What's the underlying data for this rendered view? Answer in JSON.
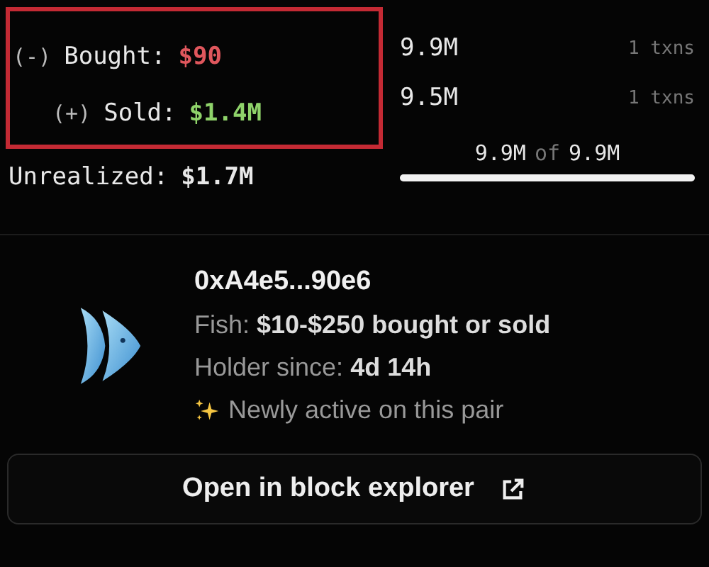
{
  "summary": {
    "highlighted": true,
    "trades": [
      {
        "kind": "buy",
        "sign": "(-)",
        "label": "Bought:",
        "amount": "$90",
        "tokens": "9.9M",
        "txns": "1 txns"
      },
      {
        "kind": "sell",
        "sign": "(+)",
        "label": "Sold:",
        "amount": "$1.4M",
        "tokens": "9.5M",
        "txns": "1 txns"
      }
    ],
    "unrealized": {
      "label": "Unrealized:",
      "amount": "$1.7M"
    },
    "holding": {
      "current": "9.9M",
      "of": "of",
      "total": "9.9M",
      "level": 1
    }
  },
  "wallet": {
    "address": "0xA4e5...90e6",
    "details": [
      "Fish: **$10-$250 bought or sold**",
      "Holder since: **4d 14h**"
    ],
    "note": "Newly active on this pair"
  },
  "button": {
    "label": "Open in block explorer"
  }
}
